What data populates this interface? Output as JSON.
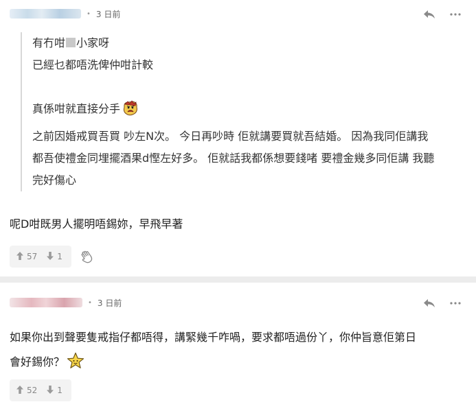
{
  "comments": [
    {
      "dot": "•",
      "time": "3 日前",
      "quote": {
        "nested": [
          "有冇咁",
          "小家呀",
          "已經乜都唔洗俾仲咁計較"
        ],
        "nested_last": "真係咁就直接分手",
        "text": [
          "之前因婚戒買吾買 吵左N次。 今日再吵時 佢就講要買就吾結婚。 因為我同佢講我",
          "都吾使禮金同埋擺酒果d慳左好多。 佢就話我都係想要錢啫 要禮金幾多同佢講 我聽",
          "完好傷心"
        ]
      },
      "body": "呢D咁既男人擺明唔錫妳，早飛早著",
      "upvotes": "57",
      "downvotes": "1"
    },
    {
      "dot": "•",
      "time": "3 日前",
      "body_lines": [
        "如果你出到聲要隻戒指仔都唔得，講緊幾千咋喎，要求都唔過份丫，你仲旨意佢第日",
        "會好錫你？"
      ],
      "upvotes": "52",
      "downvotes": "1"
    }
  ],
  "icons": {
    "reply": "reply-icon",
    "more": "more-icon",
    "upvote": "arrow-up-icon",
    "downvote": "arrow-down-icon",
    "hand": "hand-icon"
  },
  "colors": {
    "divider": "#ececec",
    "muted": "#888888",
    "vote_bg": "#f3f3f3"
  }
}
